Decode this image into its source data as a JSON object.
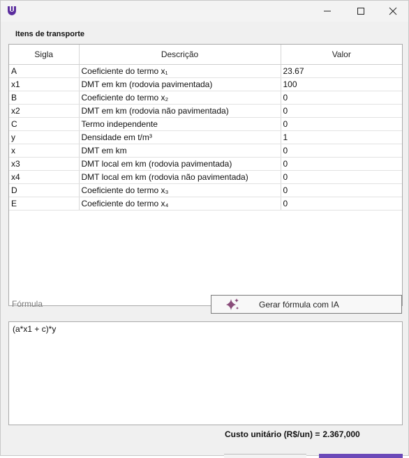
{
  "window": {
    "app_icon": "app-logo-icon",
    "controls": [
      "minimize-icon",
      "maximize-icon",
      "close-icon"
    ]
  },
  "section_title": "Itens de transporte",
  "table": {
    "headers": {
      "sigla": "Sigla",
      "descricao": "Descrição",
      "valor": "Valor"
    },
    "rows": [
      {
        "sigla": "A",
        "descricao": "Coeficiente do termo x₁",
        "valor": "23.67"
      },
      {
        "sigla": "x1",
        "descricao": "DMT em km (rodovia pavimentada)",
        "valor": "100"
      },
      {
        "sigla": "B",
        "descricao": "Coeficiente do termo x₂",
        "valor": "0"
      },
      {
        "sigla": "x2",
        "descricao": "DMT em km (rodovia não pavimentada)",
        "valor": "0"
      },
      {
        "sigla": "C",
        "descricao": "Termo independente",
        "valor": "0"
      },
      {
        "sigla": "y",
        "descricao": "Densidade em t/m³",
        "valor": "1"
      },
      {
        "sigla": "x",
        "descricao": "DMT em km",
        "valor": "0"
      },
      {
        "sigla": "x3",
        "descricao": "DMT local em km (rodovia pavimentada)",
        "valor": "0"
      },
      {
        "sigla": "x4",
        "descricao": "DMT local em km (rodovia não pavimentada)",
        "valor": "0"
      },
      {
        "sigla": "D",
        "descricao": "Coeficiente do termo x₃",
        "valor": "0"
      },
      {
        "sigla": "E",
        "descricao": "Coeficiente do termo x₄",
        "valor": "0"
      }
    ]
  },
  "formula": {
    "label": "Fórmula",
    "value": "(a*x1 + c)*y"
  },
  "ai_button": {
    "label": "Gerar fórmula com IA",
    "icon": "sparkle-icon"
  },
  "cost": {
    "label": "Custo unitário (R$/un) =",
    "value": "2.367,000"
  },
  "colors": {
    "accent": "#6b49b8",
    "logo": "#5b2d9e",
    "sparkle": "#8a4c7a"
  }
}
